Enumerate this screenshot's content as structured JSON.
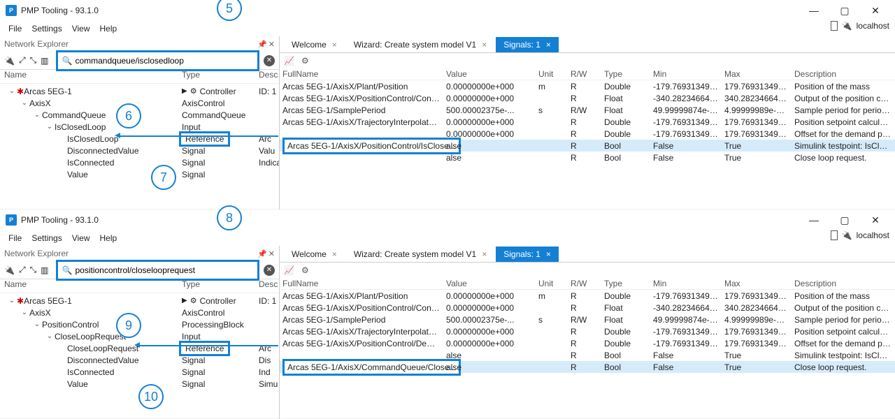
{
  "app": {
    "title": "PMP Tooling - 93.1.0"
  },
  "menu": {
    "file": "File",
    "settings": "Settings",
    "view": "View",
    "help": "Help"
  },
  "connection": {
    "status": "localhost"
  },
  "sidebar": {
    "title": "Network Explorer",
    "headers": {
      "name": "Name",
      "type": "Type",
      "desc": "Desc"
    }
  },
  "tabs": {
    "welcome": "Welcome",
    "wizard": "Wizard: Create system model V1",
    "signals": "Signals: 1"
  },
  "table_headers": {
    "fullname": "FullName",
    "value": "Value",
    "unit": "Unit",
    "rw": "R/W",
    "type": "Type",
    "min": "Min",
    "max": "Max",
    "desc": "Description"
  },
  "top": {
    "search": "commandqueue/isclosedloop",
    "tree": [
      {
        "indent": 0,
        "tw": "v",
        "icon": "dev",
        "label": "Arcas 5EG-1",
        "type": "Controller",
        "type_icons": true,
        "desc": "ID: 1"
      },
      {
        "indent": 1,
        "tw": "v",
        "label": "AxisX",
        "type": "AxisControl"
      },
      {
        "indent": 2,
        "tw": "v",
        "label": "CommandQueue",
        "type": "CommandQueue"
      },
      {
        "indent": 3,
        "tw": "v",
        "label": "IsClosedLoop",
        "type": "Input"
      },
      {
        "indent": 4,
        "tw": "",
        "label": "IsClosedLoop",
        "type": "Reference",
        "type_boxed": true,
        "desc": "Arc"
      },
      {
        "indent": 4,
        "tw": "",
        "label": "DisconnectedValue",
        "type": "Signal",
        "desc": "Valu"
      },
      {
        "indent": 4,
        "tw": "",
        "label": "IsConnected",
        "type": "Signal",
        "desc": "Indica"
      },
      {
        "indent": 4,
        "tw": "",
        "label": "Value",
        "type": "Signal"
      }
    ],
    "rows": [
      {
        "full": "Arcas 5EG-1/AxisX/Plant/Position",
        "val": "0.00000000e+000",
        "unit": "m",
        "rw": "R",
        "type": "Double",
        "min": "-179.76931349e...",
        "max": "179.76931349e+...",
        "desc": "Position of the mass"
      },
      {
        "full": "Arcas 5EG-1/AxisX/PositionControl/Contro...",
        "val": "0.00000000e+000",
        "unit": "",
        "rw": "R",
        "type": "Float",
        "min": "-340.28234664e...",
        "max": "340.28234664e+...",
        "desc": "Output of the position con..."
      },
      {
        "full": "Arcas 5EG-1/SamplePeriod",
        "val": "500.00002375e-...",
        "unit": "s",
        "rw": "R/W",
        "type": "Float",
        "min": "49.99999874e-006",
        "max": "4.99999989e-003",
        "desc": "Sample period for periodic c..."
      },
      {
        "full": "Arcas 5EG-1/AxisX/TrajectoryInterpolator/D...",
        "val": "0.00000000e+000",
        "unit": "",
        "rw": "R",
        "type": "Double",
        "min": "-179.76931349e...",
        "max": "179.76931349e+...",
        "desc": "Position setpoint calculate..."
      },
      {
        "full": "",
        "val": "0.00000000e+000",
        "unit": "",
        "rw": "R",
        "type": "Double",
        "min": "-179.76931349e...",
        "max": "179.76931349e+...",
        "desc": "Offset for the demand posi..."
      },
      {
        "full_boxed": "Arcas 5EG-1/AxisX/PositionControl/IsClose...",
        "val": "alse",
        "unit": "",
        "rw": "R",
        "type": "Bool",
        "min": "False",
        "max": "True",
        "desc": "Simulink testpoint: IsClose...",
        "selected": true
      },
      {
        "full": "",
        "val": "alse",
        "unit": "",
        "rw": "R",
        "type": "Bool",
        "min": "False",
        "max": "True",
        "desc": "Close loop request."
      }
    ],
    "callouts": {
      "c5": "5",
      "c6": "6",
      "c7": "7"
    }
  },
  "bottom": {
    "search": "positioncontrol/closelooprequest",
    "tree": [
      {
        "indent": 0,
        "tw": "v",
        "icon": "dev",
        "label": "Arcas 5EG-1",
        "type": "Controller",
        "type_icons": true,
        "desc": "ID: 1"
      },
      {
        "indent": 1,
        "tw": "v",
        "label": "AxisX",
        "type": "AxisControl"
      },
      {
        "indent": 2,
        "tw": "v",
        "label": "PositionControl",
        "type": "ProcessingBlock"
      },
      {
        "indent": 3,
        "tw": "v",
        "label": "CloseLoopRequest",
        "type": "Input"
      },
      {
        "indent": 4,
        "tw": "",
        "label": "CloseLoopRequest",
        "type": "Reference",
        "type_boxed": true,
        "desc": "Arc"
      },
      {
        "indent": 4,
        "tw": "",
        "label": "DisconnectedValue",
        "type": "Signal",
        "desc": "Dis"
      },
      {
        "indent": 4,
        "tw": "",
        "label": "IsConnected",
        "type": "Signal",
        "desc": "Ind"
      },
      {
        "indent": 4,
        "tw": "",
        "label": "Value",
        "type": "Signal",
        "desc": "Simu"
      }
    ],
    "rows": [
      {
        "full": "Arcas 5EG-1/AxisX/Plant/Position",
        "val": "0.00000000e+000",
        "unit": "m",
        "rw": "R",
        "type": "Double",
        "min": "-179.76931349e...",
        "max": "179.76931349e+...",
        "desc": "Position of the mass"
      },
      {
        "full": "Arcas 5EG-1/AxisX/PositionControl/Contro...",
        "val": "0.00000000e+000",
        "unit": "",
        "rw": "R",
        "type": "Float",
        "min": "-340.28234664e...",
        "max": "340.28234664e+...",
        "desc": "Output of the position con..."
      },
      {
        "full": "Arcas 5EG-1/SamplePeriod",
        "val": "500.00002375e-...",
        "unit": "s",
        "rw": "R/W",
        "type": "Float",
        "min": "49.99999874e-006",
        "max": "4.99999989e-003",
        "desc": "Sample period for periodic c..."
      },
      {
        "full": "Arcas 5EG-1/AxisX/TrajectoryInterpolator/D...",
        "val": "0.00000000e+000",
        "unit": "",
        "rw": "R",
        "type": "Double",
        "min": "-179.76931349e...",
        "max": "179.76931349e+...",
        "desc": "Position setpoint calculate..."
      },
      {
        "full": "Arcas 5EG-1/AxisX/PositionControl/Deman...",
        "val": "0.00000000e+000",
        "unit": "",
        "rw": "R",
        "type": "Double",
        "min": "-179.76931349e...",
        "max": "179.76931349e+...",
        "desc": "Offset for the demand posi..."
      },
      {
        "full": "",
        "val": "alse",
        "unit": "",
        "rw": "R",
        "type": "Bool",
        "min": "False",
        "max": "True",
        "desc": "Simulink testpoint: IsClose..."
      },
      {
        "full_boxed": "Arcas 5EG-1/AxisX/CommandQueue/Close...",
        "val": "alse",
        "unit": "",
        "rw": "R",
        "type": "Bool",
        "min": "False",
        "max": "True",
        "desc": "Close loop request.",
        "selected": true
      }
    ],
    "callouts": {
      "c8": "8",
      "c9": "9",
      "c10": "10"
    }
  }
}
